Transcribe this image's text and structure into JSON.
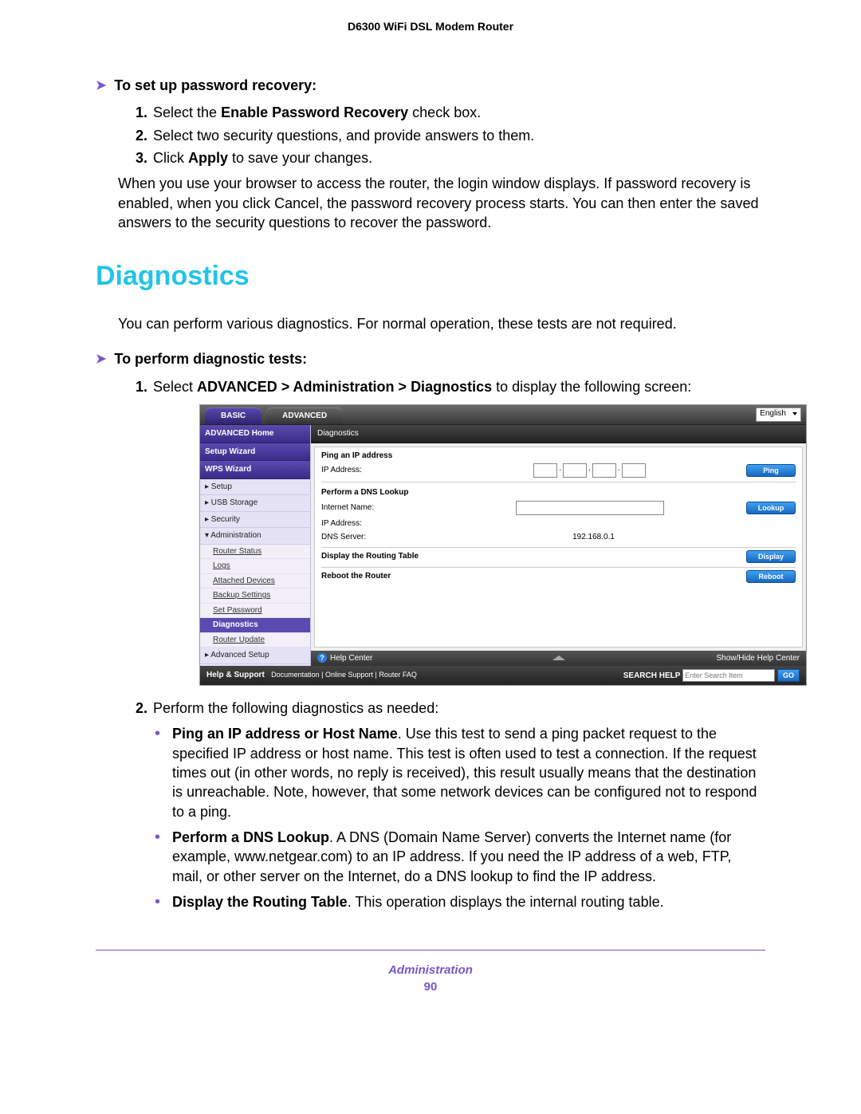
{
  "doc_header": "D6300 WiFi DSL Modem Router",
  "section_a": {
    "heading": "To set up password recovery:",
    "steps": [
      {
        "num": "1.",
        "before": "Select the ",
        "bold": "Enable Password Recovery",
        "after": " check box."
      },
      {
        "num": "2.",
        "text": "Select two security questions, and provide answers to them."
      },
      {
        "num": "3.",
        "before": "Click ",
        "bold": "Apply",
        "after": " to save your changes."
      }
    ],
    "tail": "When you use your browser to access the router, the login window displays. If password recovery is enabled, when you click Cancel, the password recovery process starts. You can then enter the saved answers to the security questions to recover the password."
  },
  "diag_title": "Diagnostics",
  "diag_intro": "You can perform various diagnostics. For normal operation, these tests are not required.",
  "section_b": {
    "heading": "To perform diagnostic tests:",
    "step1_before": "Select ",
    "step1_bold": "ADVANCED > Administration > Diagnostics",
    "step1_after": " to display the following screen:",
    "step1_num": "1.",
    "step2_num": "2.",
    "step2_text": "Perform the following diagnostics as needed:"
  },
  "bullets": [
    {
      "bold": "Ping an IP address or Host Name",
      "rest": ". Use this test to send a ping packet request to the specified IP address or host name. This test is often used to test a connection. If the request times out (in other words, no reply is received), this result usually means that the destination is unreachable. Note, however, that some network devices can be configured not to respond to a ping."
    },
    {
      "bold": "Perform a DNS Lookup",
      "rest": ". A DNS (Domain Name Server) converts the Internet name (for example, www.netgear.com) to an IP address. If you need the IP address of a web, FTP, mail, or other server on the Internet, do a DNS lookup to find the IP address."
    },
    {
      "bold": "Display the Routing Table",
      "rest": ". This operation displays the internal routing table."
    }
  ],
  "ui": {
    "tabs": {
      "basic": "BASIC",
      "advanced": "ADVANCED"
    },
    "language": "English",
    "sidebar": {
      "home": "ADVANCED Home",
      "setup_wizard": "Setup Wizard",
      "wps_wizard": "WPS Wizard",
      "groups": [
        "▸ Setup",
        "▸ USB Storage",
        "▸ Security",
        "▾ Administration"
      ],
      "admin_subs": [
        "Router Status",
        "Logs",
        "Attached Devices",
        "Backup Settings",
        "Set Password",
        "Diagnostics",
        "Router Update"
      ],
      "advanced_setup": "▸ Advanced Setup"
    },
    "crumb": "Diagnostics",
    "panel": {
      "ping_title": "Ping an IP address",
      "ip_label": "IP Address:",
      "ping_btn": "Ping",
      "dns_title": "Perform a DNS Lookup",
      "dns_label": "Internet Name:",
      "lookup_btn": "Lookup",
      "ip_addr_label": "IP Address:",
      "dns_server_label": "DNS Server:",
      "dns_server_val": "192.168.0.1",
      "display_title": "Display the Routing Table",
      "display_btn": "Display",
      "reboot_title": "Reboot the Router",
      "reboot_btn": "Reboot"
    },
    "helpbar": {
      "left": "Help Center",
      "right": "Show/Hide Help Center"
    },
    "support": {
      "label": "Help & Support",
      "links": "Documentation  |  Online Support  |  Router FAQ",
      "search_label": "SEARCH HELP",
      "search_placeholder": "Enter Search Item",
      "go": "GO"
    }
  },
  "footer": {
    "section": "Administration",
    "page": "90"
  }
}
